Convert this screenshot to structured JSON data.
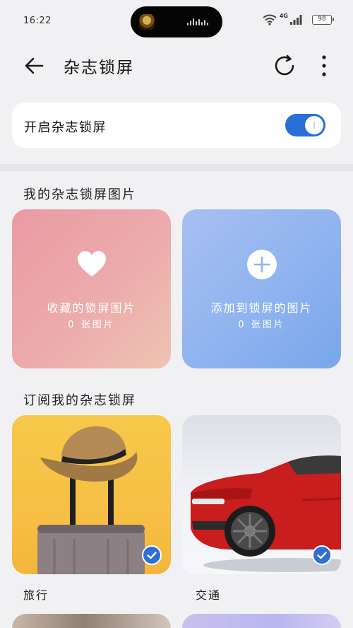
{
  "status_bar": {
    "time": "16:22",
    "network_label": "4G",
    "battery": "98"
  },
  "header": {
    "title": "杂志锁屏",
    "back_icon": "arrow-left-icon",
    "refresh_icon": "refresh-icon",
    "more_icon": "more-vertical-icon"
  },
  "toggle": {
    "label": "开启杂志锁屏",
    "enabled": true,
    "color": "#2a6ed8"
  },
  "my_section": {
    "title": "我的杂志锁屏图片",
    "tiles": [
      {
        "label": "收藏的锁屏图片",
        "count": "0 张图片",
        "icon": "heart-icon"
      },
      {
        "label": "添加到锁屏的图片",
        "count": "0 张图片",
        "icon": "plus-icon"
      }
    ]
  },
  "subscribe_section": {
    "title": "订阅我的杂志锁屏",
    "items": [
      {
        "label": "旅行",
        "subscribed": true
      },
      {
        "label": "交通",
        "subscribed": true
      }
    ]
  },
  "colors": {
    "accent": "#2d6fd6",
    "background": "#f1f1f3"
  }
}
